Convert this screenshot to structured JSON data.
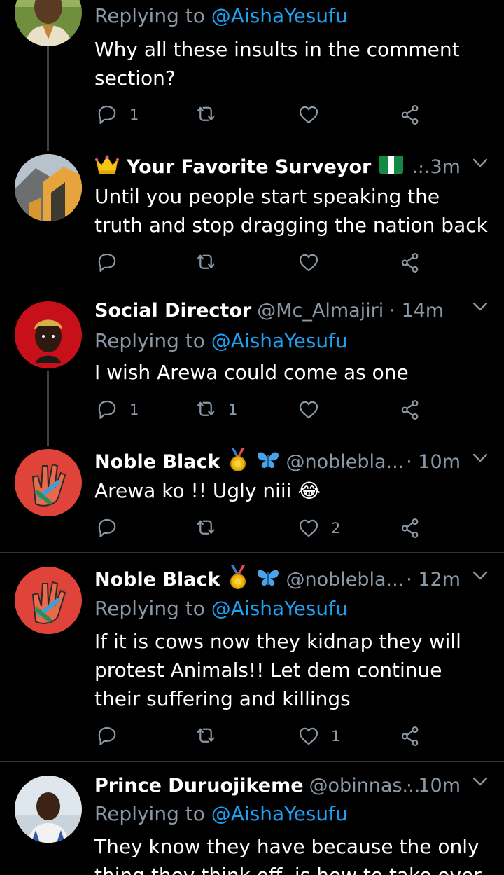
{
  "tweets": [
    {
      "reply_prefix": "Replying to ",
      "reply_to": "@AishaYesufu",
      "text": "Why all these insults in the comment section?",
      "counts": {
        "reply": "1",
        "retweet": "",
        "like": ""
      }
    },
    {
      "name": "Your Favorite Surveyor",
      "ellipsis": "...",
      "time": "· 3m",
      "text": "Until you people start speaking the truth and stop dragging the nation back",
      "counts": {
        "reply": "",
        "retweet": "",
        "like": ""
      }
    },
    {
      "name": "Social Director",
      "handle": "@Mc_Almajiri",
      "time": "· 14m",
      "reply_prefix": "Replying to ",
      "reply_to": "@AishaYesufu",
      "text": "I wish Arewa could come as one",
      "counts": {
        "reply": "1",
        "retweet": "1",
        "like": ""
      }
    },
    {
      "name": "Noble Black",
      "handle": "@noblebla...",
      "time": "· 10m",
      "text": "Arewa ko !! Ugly niii 😂",
      "counts": {
        "reply": "",
        "retweet": "",
        "like": "2"
      }
    },
    {
      "name": "Noble Black",
      "handle": "@noblebla...",
      "time": "· 12m",
      "reply_prefix": "Replying to ",
      "reply_to": "@AishaYesufu",
      "text": "If it is cows now they kidnap they will protest Animals!! Let dem continue their suffering and killings",
      "counts": {
        "reply": "",
        "retweet": "",
        "like": "1"
      }
    },
    {
      "name": "Prince Duruojikeme",
      "handle": "@obinnas...",
      "time": "· 10m",
      "reply_prefix": "Replying to ",
      "reply_to": "@AishaYesufu",
      "text": "They know they have because the only thing they think off, is how to take over"
    }
  ],
  "colors": {
    "accent": "#1da1f2",
    "muted": "#8b98a5",
    "background": "#000000",
    "divider": "#2f3336"
  }
}
